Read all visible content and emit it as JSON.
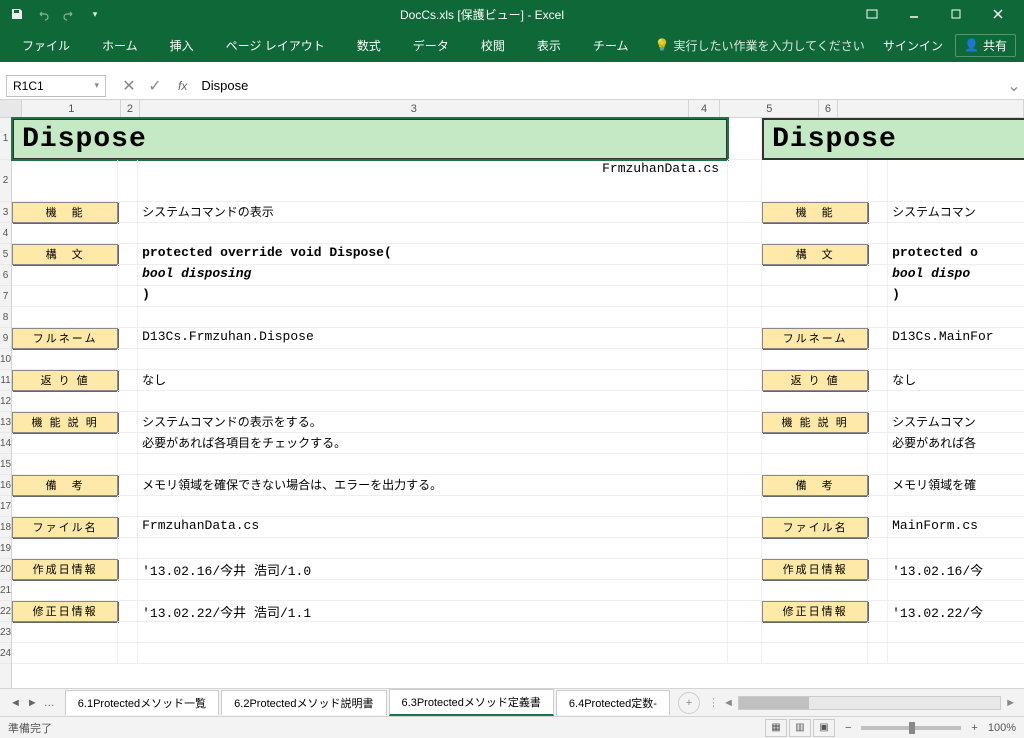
{
  "window": {
    "title": "DocCs.xls [保護ビュー] - Excel",
    "signin": "サインイン",
    "share": "共有"
  },
  "ribbon": {
    "tabs": [
      "ファイル",
      "ホーム",
      "挿入",
      "ページ レイアウト",
      "数式",
      "データ",
      "校閲",
      "表示",
      "チーム"
    ],
    "help": "実行したい作業を入力してください"
  },
  "formula": {
    "namebox": "R1C1",
    "value": "Dispose"
  },
  "sheet": {
    "title_a": "Dispose",
    "title_b": "Dispose",
    "subtitle_a": "FrmzuhanData.cs",
    "labels": {
      "func": "機　能",
      "syntax": "構　文",
      "fullname": "フルネーム",
      "return": "返 り 値",
      "desc": "機 能 説 明",
      "remark": "備　考",
      "file": "ファイル名",
      "created": "作成日情報",
      "modified": "修正日情報"
    },
    "left": {
      "func": "システムコマンドの表示",
      "syntax1": "protected override void Dispose(",
      "syntax2": " bool disposing",
      "syntax3": ")",
      "fullname": "D13Cs.Frmzuhan.Dispose",
      "return": "なし",
      "desc1": "システムコマンドの表示をする。",
      "desc2": "必要があれば各項目をチェックする。",
      "remark": "メモリ領域を確保できない場合は、エラーを出力する。",
      "file": "FrmzuhanData.cs",
      "created": "'13.02.16/今井 浩司/1.0",
      "modified": "'13.02.22/今井 浩司/1.1"
    },
    "right": {
      "func": "システムコマン",
      "syntax1": "protected o",
      "syntax2": " bool dispo",
      "syntax3": ")",
      "fullname": "D13Cs.MainFor",
      "return": "なし",
      "desc1": "システムコマン",
      "desc2": "必要があれば各",
      "remark": "メモリ領域を確",
      "file": "MainForm.cs",
      "created": "'13.02.16/今",
      "modified": "'13.02.22/今"
    }
  },
  "tabs": {
    "items": [
      "6.1Protectedメソッド一覧",
      "6.2Protectedメソッド説明書",
      "6.3Protectedメソッド定義書",
      "6.4Protected定数-"
    ],
    "active": 2
  },
  "status": {
    "ready": "準備完了",
    "zoom": "100%"
  }
}
